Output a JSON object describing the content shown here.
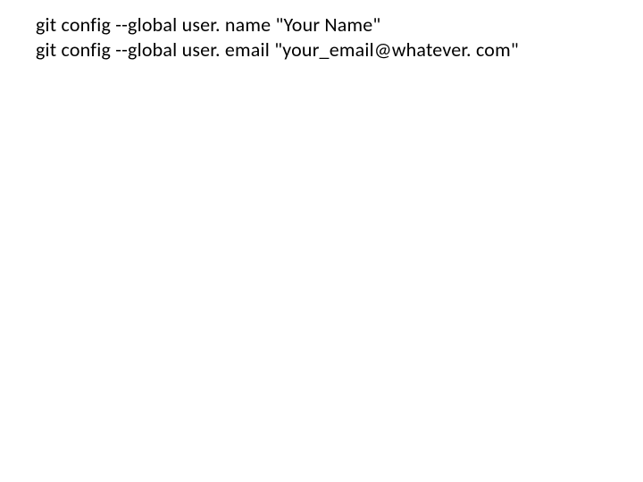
{
  "code": {
    "line1": "git config --global user. name \"Your Name\"",
    "line2": "git config --global user. email \"your_email@whatever. com\""
  }
}
